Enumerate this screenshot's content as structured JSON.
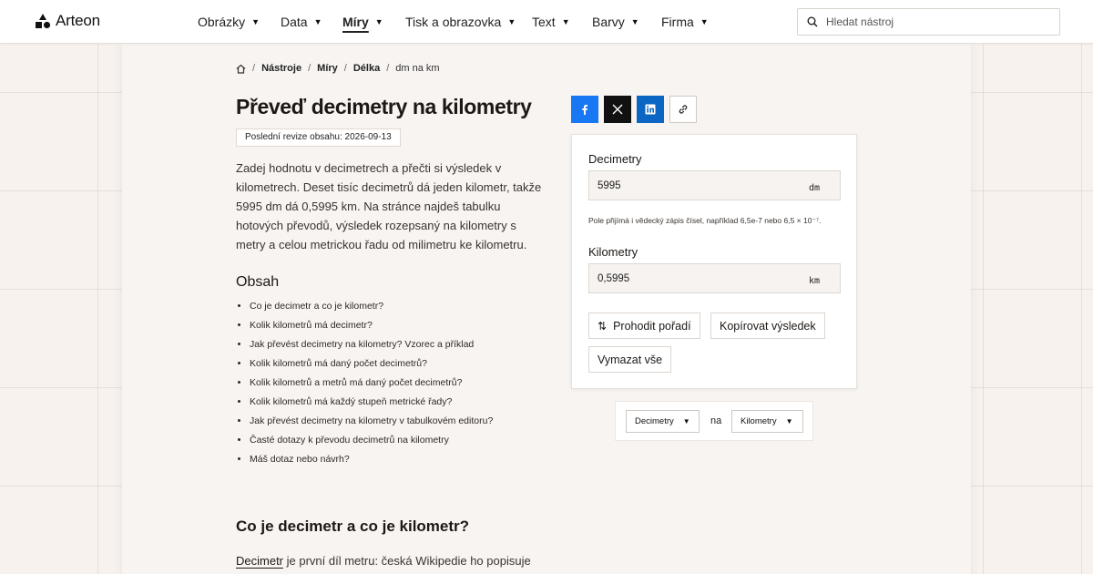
{
  "brand": {
    "name": "Arteon"
  },
  "nav": {
    "items": [
      {
        "label": "Obrázky",
        "active": false
      },
      {
        "label": "Data",
        "active": false
      },
      {
        "label": "Míry",
        "active": true
      },
      {
        "label": "Tisk a obrazovka",
        "active": false
      },
      {
        "label": "Text",
        "active": false
      },
      {
        "label": "Barvy",
        "active": false
      },
      {
        "label": "Firma",
        "active": false
      }
    ]
  },
  "search": {
    "placeholder": "Hledat nástroj",
    "value": ""
  },
  "breadcrumb": {
    "items": [
      "Nástroje",
      "Míry",
      "Délka"
    ],
    "current": "dm na km"
  },
  "page": {
    "title": "Převeď decimetry na kilometry",
    "revision": "Poslední revize obsahu: 2026-09-13",
    "intro": "Zadej hodnotu v decimetrech a přečti si výsledek v kilometrech. Deset tisíc decimetrů dá jeden kilometr, takže 5995 dm dá 0,5995 km. Na stránce najdeš tabulku hotových převodů, výsledek rozepsaný na kilometry s metry a celou metrickou řadu od milimetru ke kilometru."
  },
  "toc": {
    "title": "Obsah",
    "items": [
      "Co je decimetr a co je kilometr?",
      "Kolik kilometrů má decimetr?",
      "Jak převést decimetry na kilometry? Vzorec a příklad",
      "Kolik kilometrů má daný počet decimetrů?",
      "Kolik kilometrů a metrů má daný počet decimetrů?",
      "Kolik kilometrů má každý stupeň metrické řady?",
      "Jak převést decimetry na kilometry v tabulkovém editoru?",
      "Časté dotazy k převodu decimetrů na kilometry",
      "Máš dotaz nebo návrh?"
    ]
  },
  "section": {
    "title": "Co je decimetr a co je kilometr?",
    "link": "Decimetr",
    "text": " je první díl metru: česká Wikipedie ho popisuje"
  },
  "share": {
    "icons": [
      "facebook-icon",
      "x-icon",
      "linkedin-icon",
      "link-icon"
    ]
  },
  "converter": {
    "from_label": "Decimetry",
    "from_value": "5995",
    "from_unit": "dm",
    "hint": "Pole přijímá i vědecký zápis čísel, například 6,5e-7 nebo 6,5 × 10⁻⁷.",
    "to_label": "Kilometry",
    "to_value": "0,5995",
    "to_unit": "km",
    "swap_label": "Prohodit pořadí",
    "copy_label": "Kopírovat výsledek",
    "clear_label": "Vymazat vše"
  },
  "unit_switch": {
    "from": "Decimetry",
    "connector": "na",
    "to": "Kilometry"
  },
  "colors": {
    "facebook": "#1877f2",
    "x": "#111111",
    "linkedin": "#0a66c2",
    "page_background": "#f7f2ee"
  }
}
